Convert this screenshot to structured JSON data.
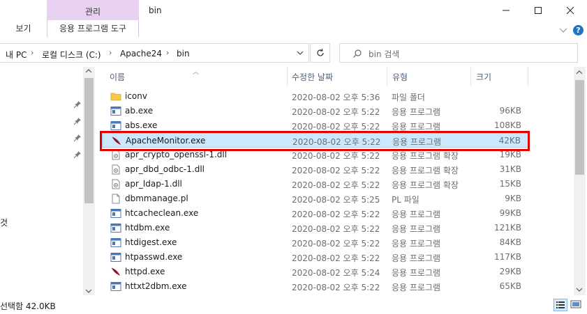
{
  "window": {
    "title": "bin"
  },
  "ribbon": {
    "context_group_label": "관리",
    "tab_view": "보기",
    "tab_app_tools": "응용 프로그램 도구"
  },
  "address": {
    "crumbs": [
      "내 PC",
      "로컬 디스크 (C:)",
      "Apache24",
      "bin"
    ]
  },
  "search": {
    "placeholder": "bin 검색"
  },
  "nav": {
    "truncated_item": "것"
  },
  "columns": {
    "name": "이름",
    "date": "수정한 날짜",
    "type": "유형",
    "size": "크기"
  },
  "files": [
    {
      "name": "iconv",
      "date": "2020-08-02 오후 5:36",
      "type": "파일 폴더",
      "size": "",
      "icon": "folder-icon"
    },
    {
      "name": "ab.exe",
      "date": "2020-08-02 오후 5:22",
      "type": "응용 프로그램",
      "size": "96KB",
      "icon": "exe-icon"
    },
    {
      "name": "abs.exe",
      "date": "2020-08-02 오후 5:22",
      "type": "응용 프로그램",
      "size": "108KB",
      "icon": "exe-icon"
    },
    {
      "name": "ApacheMonitor.exe",
      "date": "2020-08-02 오후 5:22",
      "type": "응용 프로그램",
      "size": "42KB",
      "icon": "feather-icon",
      "selected": true
    },
    {
      "name": "apr_crypto_openssl-1.dll",
      "date": "2020-08-02 오후 5:22",
      "type": "응용 프로그램 확장",
      "size": "19KB",
      "icon": "dll-icon"
    },
    {
      "name": "apr_dbd_odbc-1.dll",
      "date": "2020-08-02 오후 5:22",
      "type": "응용 프로그램 확장",
      "size": "31KB",
      "icon": "dll-icon"
    },
    {
      "name": "apr_ldap-1.dll",
      "date": "2020-08-02 오후 5:22",
      "type": "응용 프로그램 확장",
      "size": "15KB",
      "icon": "dll-icon"
    },
    {
      "name": "dbmmanage.pl",
      "date": "2020-08-02 오후 5:25",
      "type": "PL 파일",
      "size": "9KB",
      "icon": "file-icon"
    },
    {
      "name": "htcacheclean.exe",
      "date": "2020-08-02 오후 5:22",
      "type": "응용 프로그램",
      "size": "99KB",
      "icon": "exe-icon"
    },
    {
      "name": "htdbm.exe",
      "date": "2020-08-02 오후 5:22",
      "type": "응용 프로그램",
      "size": "121KB",
      "icon": "exe-icon"
    },
    {
      "name": "htdigest.exe",
      "date": "2020-08-02 오후 5:22",
      "type": "응용 프로그램",
      "size": "84KB",
      "icon": "exe-icon"
    },
    {
      "name": "htpasswd.exe",
      "date": "2020-08-02 오후 5:22",
      "type": "응용 프로그램",
      "size": "117KB",
      "icon": "exe-icon"
    },
    {
      "name": "httpd.exe",
      "date": "2020-08-02 오후 5:24",
      "type": "응용 프로그램",
      "size": "29KB",
      "icon": "feather-icon"
    },
    {
      "name": "httxt2dbm.exe",
      "date": "2020-08-02 오후 5:22",
      "type": "응용 프로그램",
      "size": "65KB",
      "icon": "exe-icon"
    }
  ],
  "status": {
    "text": "선택함 42.0KB"
  },
  "colors": {
    "selection": "#cce8ff",
    "selection_border": "#99d1ff",
    "highlight": "#e00000",
    "context_tab": "#e8d0f0"
  }
}
